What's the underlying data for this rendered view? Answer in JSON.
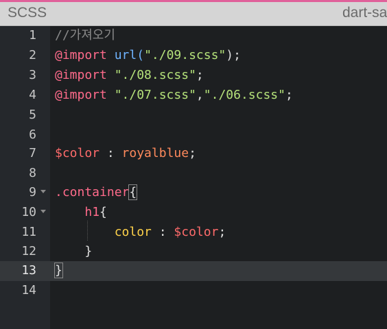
{
  "header": {
    "title": "SCSS",
    "compiler": "dart-sa"
  },
  "colors": {
    "accent_bar": "#e0609a",
    "comment": "#8a8a8a",
    "at_rule": "#ff6b8b",
    "function": "#6fb3ff",
    "string": "#b5e27a",
    "variable": "#ff6b6b",
    "value": "#ff8a5c",
    "property": "#ffd24a"
  },
  "editor": {
    "active_line": 13,
    "lines": [
      {
        "number": "1",
        "text": "//가져오기"
      },
      {
        "number": "2",
        "at": "@import",
        "fn": "url(",
        "str": "\"./09.scss\"",
        "tail": ");"
      },
      {
        "number": "3",
        "at": "@import",
        "str": "\"./08.scss\"",
        "tail": ";"
      },
      {
        "number": "4",
        "at": "@import",
        "str1": "\"./07.scss\"",
        "comma": ",",
        "str2": "\"./06.scss\"",
        "tail": ";"
      },
      {
        "number": "5"
      },
      {
        "number": "6"
      },
      {
        "number": "7",
        "var": "$color",
        "sep": " : ",
        "val": "royalblue",
        "tail": ";"
      },
      {
        "number": "8"
      },
      {
        "number": "9",
        "sel": ".container",
        "brace": "{"
      },
      {
        "number": "10",
        "indent": "    ",
        "sel": "h1",
        "brace": "{"
      },
      {
        "number": "11",
        "indent": "        ",
        "prop": "color",
        "sep": " : ",
        "var": "$color",
        "tail": ";"
      },
      {
        "number": "12",
        "indent": "    ",
        "brace": "}"
      },
      {
        "number": "13",
        "brace": "}"
      },
      {
        "number": "14"
      }
    ]
  }
}
